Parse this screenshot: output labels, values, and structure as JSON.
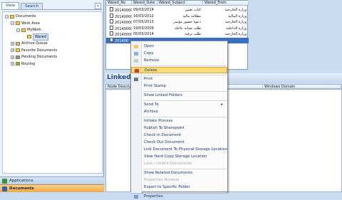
{
  "left_panel": {
    "tabs": [
      "View",
      "Search"
    ],
    "collapse_glyph": "»",
    "tree": [
      {
        "label": "Documents",
        "level": 0,
        "expander": "−",
        "icon": "folder-icon",
        "color": "#f1cd5a"
      },
      {
        "label": "Work Area",
        "level": 1,
        "expander": "−",
        "icon": "folder-icon",
        "color": "#f1cd5a"
      },
      {
        "label": "MyWork",
        "level": 2,
        "expander": "−",
        "icon": "folder-icon",
        "color": "#f1cd5a"
      },
      {
        "label": "Wared",
        "level": 3,
        "expander": "",
        "icon": "folder-icon",
        "color": "#f1cd5a",
        "selected": true
      },
      {
        "label": "Archive Queue",
        "level": 1,
        "expander": "+",
        "icon": "archive-icon",
        "color": "#b7bec9"
      },
      {
        "label": "Favorite Documents",
        "level": 1,
        "expander": "+",
        "icon": "star-folder-icon",
        "color": "#f1cd5a"
      },
      {
        "label": "Pending Documents",
        "level": 1,
        "expander": "+",
        "icon": "pending-folder-icon",
        "color": "#6a9be0"
      },
      {
        "label": "Routing",
        "level": 1,
        "expander": "+",
        "icon": "routing-icon",
        "color": "#6fbf58"
      }
    ],
    "nav_bars": [
      {
        "label": "Applications",
        "icon": "applications-icon"
      },
      {
        "label": "Documents",
        "icon": "documents-icon"
      }
    ]
  },
  "grid": {
    "columns": [
      "Wared_No",
      "Wared_Date",
      "Wared_Subject",
      "Wared_From"
    ],
    "rows": [
      {
        "no": "201400001",
        "date": "09/03/2014",
        "subject": "كتاب تعيين",
        "from": "وزارة الخارجية",
        "selected": false
      },
      {
        "no": "201400002",
        "date": "16/03/2012",
        "subject": "مطالبة مالية",
        "from": "وزارة المالية",
        "selected": false
      },
      {
        "no": "201400003",
        "date": "07/05/2013",
        "subject": "دعوة حضور مؤتمر",
        "from": "وزارة الخارجية",
        "selected": false
      },
      {
        "no": "201400004",
        "date": "19/03/2009",
        "subject": "طلب صيانة عاجلة",
        "from": "وزارة الداخلية",
        "selected": false
      },
      {
        "no": "201400005",
        "date": "05/03/2014",
        "subject": "طلب ترقية",
        "from": "وزارة الخارجية",
        "selected": false
      },
      {
        "no": "201400",
        "date": "",
        "subject": "",
        "from": "",
        "selected": true
      }
    ]
  },
  "linked": {
    "title": "Linked F",
    "columns": [
      "Node Description",
      "Windows Domain"
    ]
  },
  "context_menu": {
    "items": [
      {
        "label": "Open",
        "icon": "open-icon",
        "disabled": false,
        "arrow": false,
        "highlight": false,
        "sep_before": false
      },
      {
        "label": "Copy",
        "icon": "copy-icon",
        "disabled": false,
        "arrow": false,
        "highlight": false,
        "sep_before": false
      },
      {
        "label": "Remove",
        "icon": "remove-icon",
        "disabled": false,
        "arrow": false,
        "highlight": false,
        "sep_before": false
      },
      {
        "label": "Delete",
        "icon": "delete-icon",
        "disabled": false,
        "arrow": false,
        "highlight": true,
        "sep_before": true
      },
      {
        "label": "Print",
        "icon": "print-icon",
        "disabled": false,
        "arrow": false,
        "highlight": false,
        "sep_before": true
      },
      {
        "label": "Print Stamp",
        "icon": "",
        "disabled": false,
        "arrow": false,
        "highlight": false,
        "sep_before": false
      },
      {
        "label": "Show Linked Folders",
        "icon": "",
        "disabled": false,
        "arrow": false,
        "highlight": false,
        "sep_before": true
      },
      {
        "label": "Send To",
        "icon": "",
        "disabled": false,
        "arrow": true,
        "highlight": false,
        "sep_before": true
      },
      {
        "label": "Archive",
        "icon": "",
        "disabled": false,
        "arrow": false,
        "highlight": false,
        "sep_before": false
      },
      {
        "label": "Initiate Process",
        "icon": "",
        "disabled": false,
        "arrow": false,
        "highlight": false,
        "sep_before": true
      },
      {
        "label": "Publish To Sharepoint",
        "icon": "",
        "disabled": false,
        "arrow": false,
        "highlight": false,
        "sep_before": false
      },
      {
        "label": "Check In Document",
        "icon": "",
        "disabled": false,
        "arrow": false,
        "highlight": false,
        "sep_before": false
      },
      {
        "label": "Check Out Document",
        "icon": "",
        "disabled": false,
        "arrow": false,
        "highlight": false,
        "sep_before": false
      },
      {
        "label": "Link Document To Physical Storage Location",
        "icon": "",
        "disabled": false,
        "arrow": false,
        "highlight": false,
        "sep_before": false
      },
      {
        "label": "View Hard Copy Storage Location",
        "icon": "",
        "disabled": false,
        "arrow": false,
        "highlight": false,
        "sep_before": false
      },
      {
        "label": "Lock / Unlock Documents",
        "icon": "",
        "disabled": true,
        "arrow": false,
        "highlight": false,
        "sep_before": false
      },
      {
        "label": "Show Related Documents",
        "icon": "",
        "disabled": false,
        "arrow": false,
        "highlight": false,
        "sep_before": true
      },
      {
        "label": "Properties Browser",
        "icon": "",
        "disabled": true,
        "arrow": false,
        "highlight": false,
        "sep_before": false
      },
      {
        "label": "Export to Specific Folder",
        "icon": "",
        "disabled": false,
        "arrow": false,
        "highlight": false,
        "sep_before": false
      },
      {
        "label": "Properties",
        "icon": "properties-icon",
        "disabled": false,
        "arrow": false,
        "highlight": false,
        "sep_before": true
      }
    ]
  }
}
